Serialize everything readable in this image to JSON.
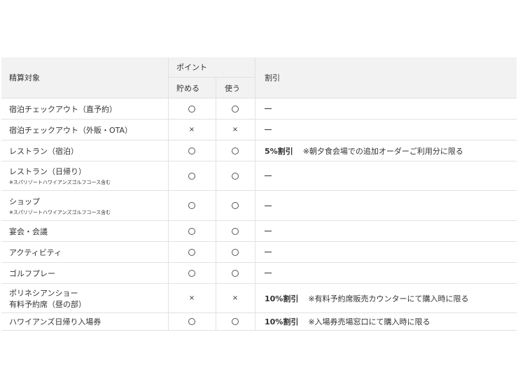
{
  "header": {
    "target": "精算対象",
    "points": "ポイント",
    "save": "貯める",
    "use": "使う",
    "discount": "割引"
  },
  "rows": [
    {
      "name": "宿泊チェックアウト（直予約）",
      "sub": "",
      "save": "circle",
      "use": "circle",
      "discount": "",
      "note": ""
    },
    {
      "name": "宿泊チェックアウト（外販・OTA）",
      "sub": "",
      "save": "cross",
      "use": "cross",
      "discount": "",
      "note": ""
    },
    {
      "name": "レストラン（宿泊）",
      "sub": "",
      "save": "circle",
      "use": "circle",
      "discount": "5%割引",
      "note": "※朝夕食会場での追加オーダーご利用分に限る"
    },
    {
      "name": "レストラン（日帰り）",
      "sub": "※スパリゾートハワイアンズゴルフコース含む",
      "save": "circle",
      "use": "circle",
      "discount": "",
      "note": ""
    },
    {
      "name": "ショップ",
      "sub": "※スパリゾートハワイアンズゴルフコース含む",
      "save": "circle",
      "use": "circle",
      "discount": "",
      "note": ""
    },
    {
      "name": "宴会・会議",
      "sub": "",
      "save": "circle",
      "use": "circle",
      "discount": "",
      "note": ""
    },
    {
      "name": "アクティビティ",
      "sub": "",
      "save": "circle",
      "use": "circle",
      "discount": "",
      "note": ""
    },
    {
      "name": "ゴルフプレー",
      "sub": "",
      "save": "circle",
      "use": "circle",
      "discount": "",
      "note": ""
    },
    {
      "name": "ポリネシアンショー\n有料予約席（昼の部）",
      "sub": "",
      "save": "cross",
      "use": "cross",
      "discount": "10%割引",
      "note": "※有料予約席販売カウンターにて購入時に限る"
    },
    {
      "name": "ハワイアンズ日帰り入場券",
      "sub": "",
      "save": "circle",
      "use": "circle",
      "discount": "10%割引",
      "note": "※入場券売場窓口にて購入時に限る"
    }
  ]
}
